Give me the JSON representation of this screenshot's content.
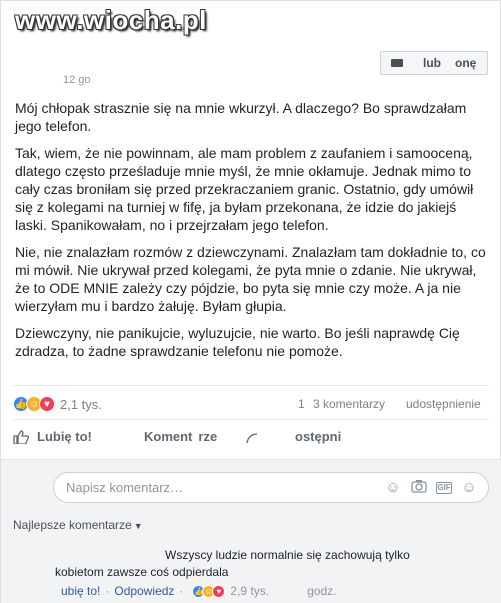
{
  "watermark": "www.wiocha.pl",
  "post": {
    "timestamp": "12 go",
    "like_page": {
      "part1": "lub",
      "part2": "onę"
    },
    "paragraphs": [
      "Mój chłopak strasznie się na mnie wkurzył. A dlaczego? Bo sprawdzałam jego telefon.",
      "Tak, wiem, że nie powinnam, ale mam problem z zaufaniem i samooceną, dlatego często prześladuje mnie myśl, że mnie okłamuje. Jednak mimo to cały czas broniłam się przed przekraczaniem granic. Ostatnio, gdy umówił się z kolegami na turniej w fifę, ja byłam przekonana, że idzie do jakiejś laski. Spanikowałam, no i przejrzałam jego telefon.",
      "Nie, nie znalazłam rozmów z dziewczynami. Znalazłam tam dokładnie to, co mi mówił. Nie ukrywał przed kolegami, że pyta mnie o zdanie. Nie ukrywał, że to ODE MNIE zależy czy pójdzie, bo pyta się mnie czy może. A ja nie wierzyłam mu i bardzo żałuję. Byłam głupia.",
      "Dziewczyny, nie panikujcie, wyluzujcie, nie warto. Bo jeśli naprawdę Cię zdradza, to żadne sprawdzanie telefonu nie pomoże."
    ],
    "reactions_count": "2,1 tys.",
    "comments_num": "1",
    "comments_label": "3 komentarzy",
    "shares_label": "udostępnienie"
  },
  "actions": {
    "like": "Lubię to!",
    "comment_a": "Koment",
    "comment_b": "rze",
    "share": "ostępni"
  },
  "comment_area": {
    "placeholder": "Napisz komentarz…",
    "sort_label": "Najlepsze komentarze",
    "comment_line1": "Wszyscy ludzie normalnie się zachowują tylko",
    "comment_line2": "kobietom zawsze coś odpierdala",
    "like_action": "ubię to!",
    "reply_action": "Odpowiedz",
    "reactions_count": "2,9 tys.",
    "time": "godz."
  },
  "colors": {
    "like": "#2d88ff",
    "haha": "#f7b125",
    "love": "#f33e58",
    "link": "#385898"
  },
  "icons": [
    "like-icon",
    "haha-icon",
    "love-icon",
    "thumb-icon",
    "comment-icon",
    "share-icon",
    "emoji-icon",
    "camera-icon",
    "gif-icon",
    "sticker-icon"
  ]
}
